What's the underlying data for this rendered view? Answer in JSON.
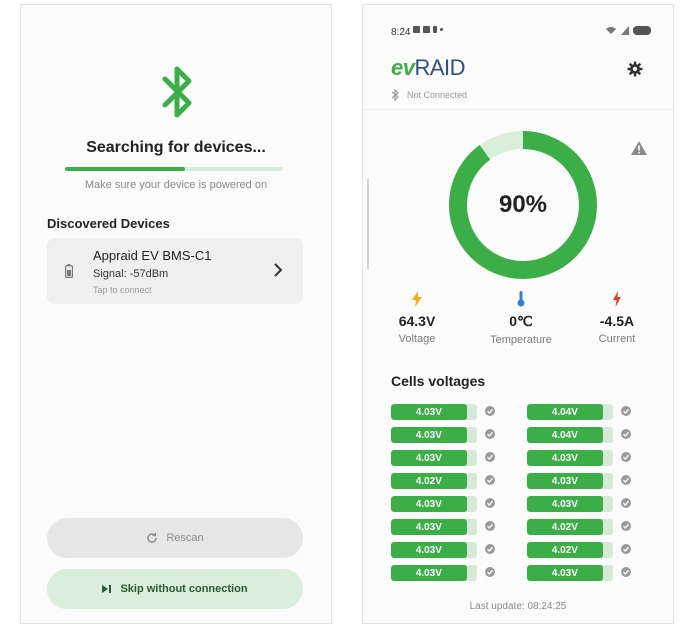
{
  "left_screen": {
    "title": "Searching for devices...",
    "search_progress": 0.55,
    "hint": "Make sure your device is powered on",
    "section_title": "Discovered Devices",
    "device": {
      "name": "Appraid EV BMS-C1",
      "signal": "Signal: -57dBm",
      "tap_hint": "Tap to connect"
    },
    "rescan_label": "Rescan",
    "skip_label": "Skip without connection"
  },
  "right_screen": {
    "status_time": "8:24",
    "logo_ev": "ev",
    "logo_raid": "RAID",
    "connection_status": "Not Connected",
    "charge_percent": 90,
    "charge_label": "90%",
    "metrics": {
      "voltage": {
        "value": "64.3V",
        "label": "Voltage"
      },
      "temperature": {
        "value": "0℃",
        "label": "Temperature"
      },
      "current": {
        "value": "-4.5A",
        "label": "Current"
      }
    },
    "cells_title": "Cells voltages",
    "cells_left": [
      "4.03V",
      "4.03V",
      "4.03V",
      "4.02V",
      "4.03V",
      "4.03V",
      "4.03V",
      "4.03V"
    ],
    "cells_right": [
      "4.04V",
      "4.04V",
      "4.03V",
      "4.03V",
      "4.03V",
      "4.02V",
      "4.02V",
      "4.03V"
    ],
    "last_update": "Last update: 08:24:25"
  },
  "colors": {
    "accent_green": "#3cae47",
    "logo_blue": "#2b4f86",
    "voltage_icon": "#f2b11a",
    "temperature_icon": "#2f7fd6",
    "current_icon": "#e53935"
  }
}
